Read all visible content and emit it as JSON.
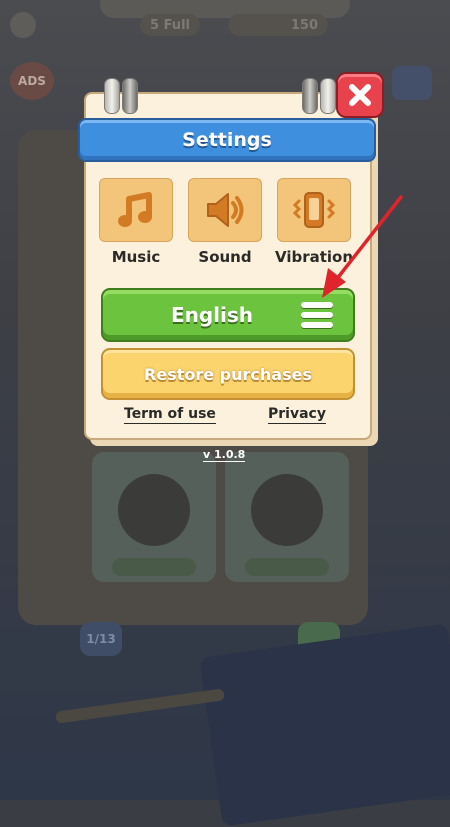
{
  "background": {
    "lives": "5",
    "lives_status": "Full",
    "coins": "150",
    "ads_label": "ADS",
    "page_indicator": "1/13"
  },
  "settings": {
    "title": "Settings",
    "options": [
      {
        "label": "Music",
        "icon": "music-note-icon"
      },
      {
        "label": "Sound",
        "icon": "speaker-icon"
      },
      {
        "label": "Vibration",
        "icon": "phone-vibration-icon"
      }
    ],
    "language_button": "English",
    "restore_button": "Restore purchases",
    "term_link": "Term of use",
    "privacy_link": "Privacy",
    "version": "v 1.0.8"
  },
  "colors": {
    "header_blue": "#3f8fdf",
    "close_red": "#e8424c",
    "green_button": "#6cc43e",
    "yellow_button": "#fbd46e",
    "tile_orange": "#f2c57a",
    "annotation_arrow": "#e0242c"
  }
}
